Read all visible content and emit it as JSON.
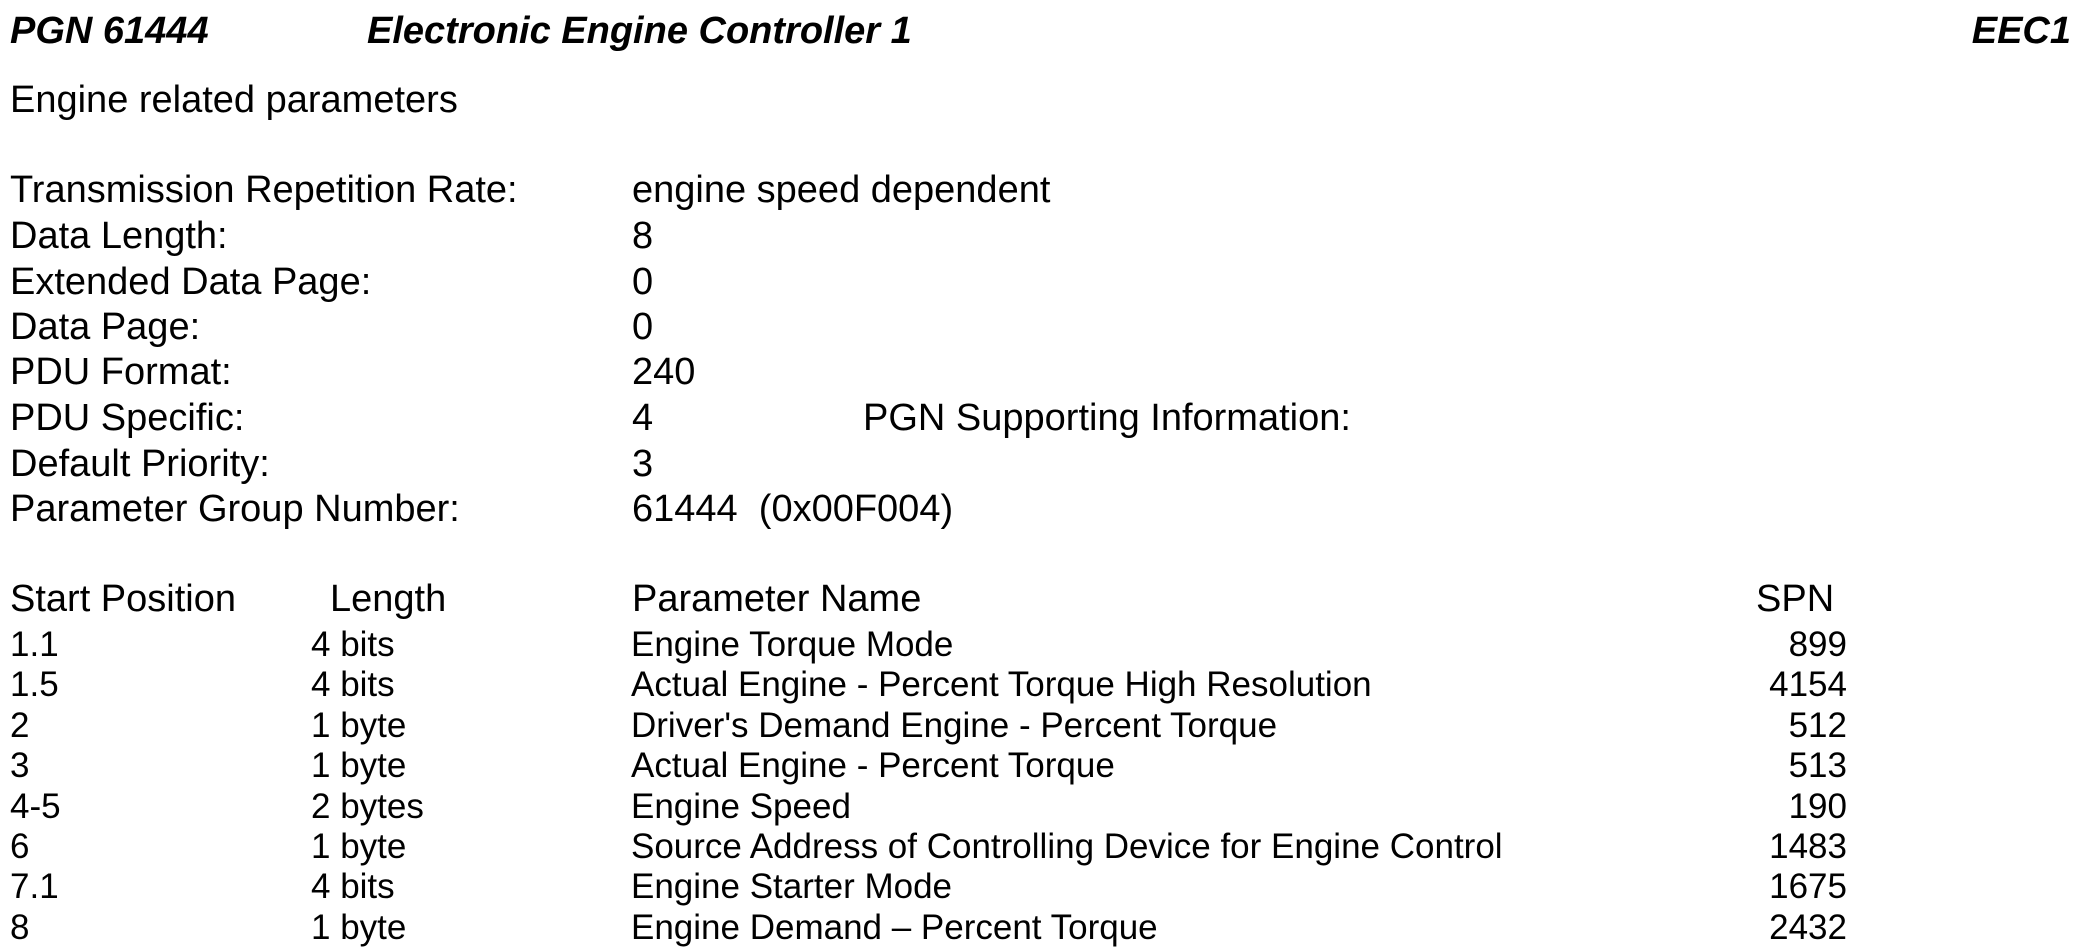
{
  "header": {
    "pgn": "PGN 61444",
    "title": "Electronic Engine Controller 1",
    "acronym": "EEC1"
  },
  "description": "Engine related parameters",
  "properties": [
    {
      "label": "Transmission Repetition Rate:",
      "value": "engine speed dependent"
    },
    {
      "label": "Data Length:",
      "value": "8"
    },
    {
      "label": "Extended Data Page:",
      "value": "0"
    },
    {
      "label": "Data Page:",
      "value": "0"
    },
    {
      "label": "PDU Format:",
      "value": "240"
    },
    {
      "label": "PDU Specific:",
      "value": "4"
    },
    {
      "label": "Default Priority:",
      "value": "3"
    },
    {
      "label": "Parameter Group Number:",
      "value": "61444  (0x00F004)"
    }
  ],
  "supporting_info_label": "PGN Supporting Information:",
  "table": {
    "headers": {
      "start_position": "Start Position",
      "length": "Length",
      "parameter_name": "Parameter Name",
      "spn": "SPN"
    },
    "rows": [
      {
        "start": "1.1",
        "length": "4 bits",
        "name": "Engine Torque Mode",
        "spn": "899"
      },
      {
        "start": "1.5",
        "length": "4 bits",
        "name": "Actual Engine - Percent Torque High Resolution",
        "spn": "4154"
      },
      {
        "start": "2",
        "length": "1 byte",
        "name": "Driver's Demand Engine - Percent Torque",
        "spn": "512"
      },
      {
        "start": "3",
        "length": "1 byte",
        "name": "Actual Engine - Percent Torque",
        "spn": "513"
      },
      {
        "start": "4-5",
        "length": "2 bytes",
        "name": "Engine Speed",
        "spn": "190"
      },
      {
        "start": "6",
        "length": "1 byte",
        "name": "Source Address of Controlling Device for Engine Control",
        "spn": "1483"
      },
      {
        "start": "7.1",
        "length": "4 bits",
        "name": "Engine Starter Mode",
        "spn": "1675"
      },
      {
        "start": "8",
        "length": "1 byte",
        "name": "Engine Demand – Percent Torque",
        "spn": "2432"
      }
    ]
  }
}
